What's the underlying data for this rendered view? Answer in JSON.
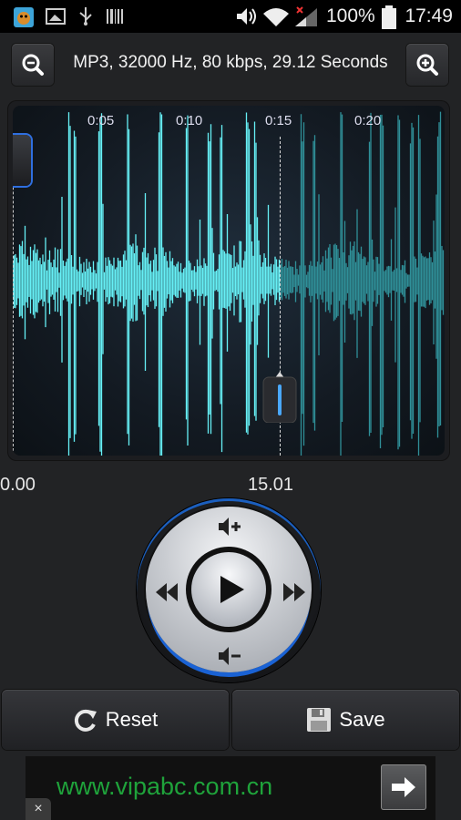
{
  "status_bar": {
    "battery_percent": "100%",
    "time": "17:49",
    "icons": [
      "app-notification-icon",
      "screenshot-icon",
      "usb-icon",
      "barcode-icon",
      "volume-icon",
      "wifi-icon",
      "signal-icon",
      "battery-icon"
    ]
  },
  "header": {
    "file_info": "MP3, 32000 Hz, 80 kbps, 29.12 Seconds",
    "zoom_out_icon": "zoom-out-icon",
    "zoom_in_icon": "zoom-in-icon"
  },
  "waveform": {
    "ticks": [
      "0:05",
      "0:10",
      "0:15",
      "0:20"
    ],
    "start_time": "0.00",
    "cursor_time": "15.01",
    "played_color": "#66f0f6",
    "unplayed_color": "#2f8f98"
  },
  "controls": {
    "volume_up_icon": "volume-up-icon",
    "volume_down_icon": "volume-down-icon",
    "rewind_icon": "rewind-icon",
    "forward_icon": "fast-forward-icon",
    "play_icon": "play-icon"
  },
  "actions": {
    "reset_label": "Reset",
    "save_label": "Save"
  },
  "ad": {
    "text": "www.vipabc.com.cn",
    "close_label": "×"
  }
}
